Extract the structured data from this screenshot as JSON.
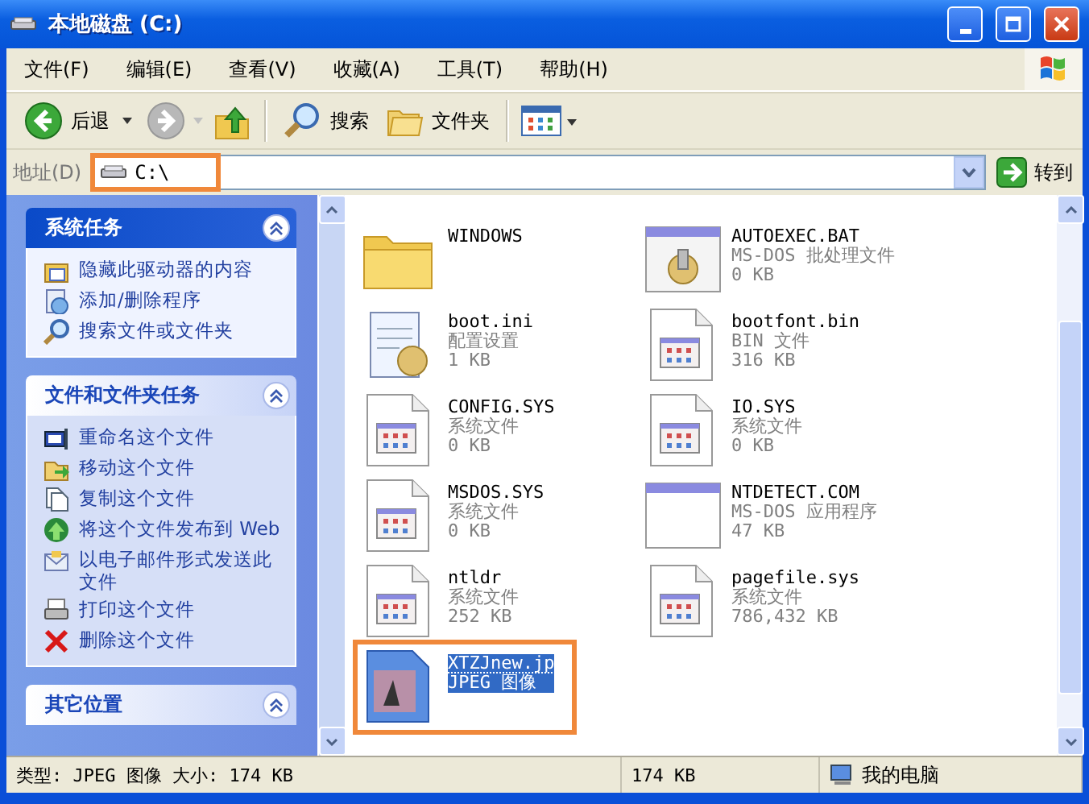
{
  "window": {
    "title": "本地磁盘 (C:)"
  },
  "menu": [
    {
      "label": "文件(F)"
    },
    {
      "label": "编辑(E)"
    },
    {
      "label": "查看(V)"
    },
    {
      "label": "收藏(A)"
    },
    {
      "label": "工具(T)"
    },
    {
      "label": "帮助(H)"
    }
  ],
  "toolbar": {
    "back": "后退",
    "search": "搜索",
    "folders": "文件夹"
  },
  "address": {
    "label": "地址(D)",
    "value": "C:\\",
    "highlighted": true,
    "go": "转到"
  },
  "task_panels": [
    {
      "title": "系统任务",
      "expanded": true,
      "items": [
        {
          "label": "隐藏此驱动器的内容"
        },
        {
          "label": "添加/删除程序"
        },
        {
          "label": "搜索文件或文件夹"
        }
      ]
    },
    {
      "title": "文件和文件夹任务",
      "expanded": true,
      "items": [
        {
          "label": "重命名这个文件"
        },
        {
          "label": "移动这个文件"
        },
        {
          "label": "复制这个文件"
        },
        {
          "label": "将这个文件发布到 Web"
        },
        {
          "label": "以电子邮件形式发送此文件"
        },
        {
          "label": "打印这个文件"
        },
        {
          "label": "删除这个文件"
        }
      ]
    },
    {
      "title": "其它位置",
      "expanded": true
    }
  ],
  "files": [
    {
      "name": "WINDOWS",
      "kind": "folder",
      "selected": false,
      "highlighted": false
    },
    {
      "name": "AUTOEXEC.BAT",
      "type": "MS-DOS 批处理文件",
      "size": "0 KB",
      "kind": "batch",
      "selected": false,
      "highlighted": false
    },
    {
      "name": "boot.ini",
      "type": "配置设置",
      "size": "1 KB",
      "kind": "config",
      "selected": false,
      "highlighted": false
    },
    {
      "name": "bootfont.bin",
      "type": "BIN 文件",
      "size": "316 KB",
      "kind": "system",
      "selected": false,
      "highlighted": false
    },
    {
      "name": "CONFIG.SYS",
      "type": "系统文件",
      "size": "0 KB",
      "kind": "system",
      "selected": false,
      "highlighted": false
    },
    {
      "name": "IO.SYS",
      "type": "系统文件",
      "size": "0 KB",
      "kind": "system",
      "selected": false,
      "highlighted": false
    },
    {
      "name": "MSDOS.SYS",
      "type": "系统文件",
      "size": "0 KB",
      "kind": "system",
      "selected": false,
      "highlighted": false
    },
    {
      "name": "NTDETECT.COM",
      "type": "MS-DOS 应用程序",
      "size": "47 KB",
      "kind": "app",
      "selected": false,
      "highlighted": false
    },
    {
      "name": "ntldr",
      "type": "系统文件",
      "size": "252 KB",
      "kind": "system",
      "selected": false,
      "highlighted": false
    },
    {
      "name": "pagefile.sys",
      "type": "系统文件",
      "size": "786,432 KB",
      "kind": "system",
      "selected": false,
      "highlighted": false
    },
    {
      "name": "XTZJnew.jp",
      "type": "JPEG 图像",
      "kind": "image",
      "selected": true,
      "highlighted": true
    }
  ],
  "status_bar": [
    {
      "text": "类型: JPEG 图像 大小: 174 KB"
    },
    {
      "text": "174 KB"
    },
    {
      "text": "我的电脑"
    }
  ]
}
